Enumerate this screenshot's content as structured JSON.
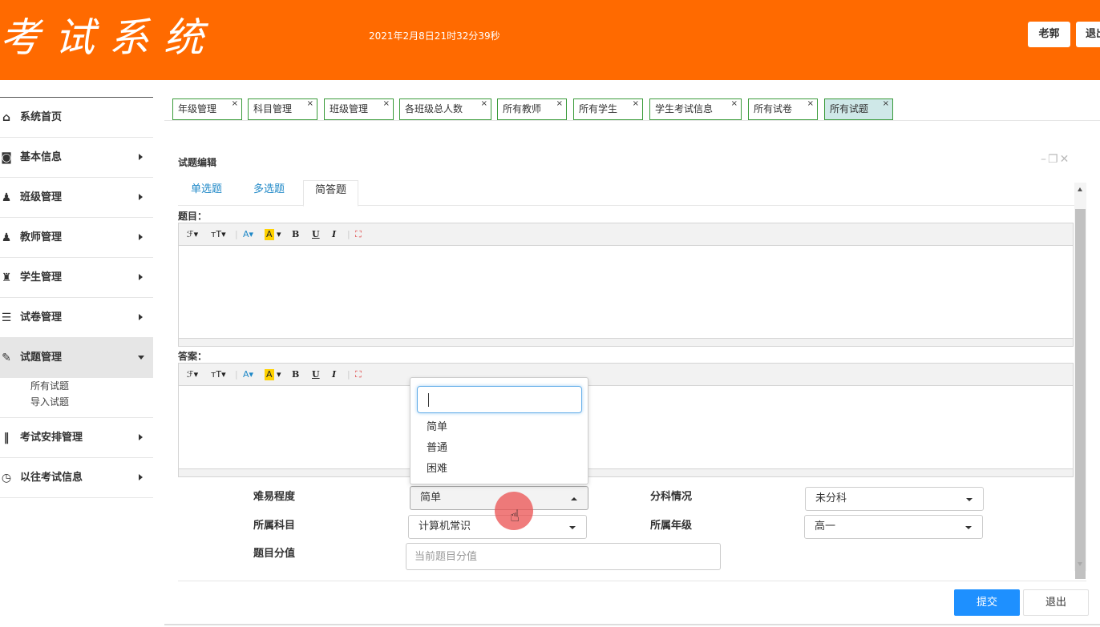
{
  "header": {
    "logo": "考试系统",
    "datetime": "2021年2月8日21时32分39秒",
    "user": "老郭",
    "exit": "退出"
  },
  "sidebar": {
    "items": [
      {
        "label": "系统首页",
        "icon": "home-icon"
      },
      {
        "label": "基本信息",
        "icon": "info-icon"
      },
      {
        "label": "班级管理",
        "icon": "class-icon"
      },
      {
        "label": "教师管理",
        "icon": "teacher-icon"
      },
      {
        "label": "学生管理",
        "icon": "student-icon"
      },
      {
        "label": "试卷管理",
        "icon": "paper-icon"
      },
      {
        "label": "试题管理",
        "icon": "question-icon"
      },
      {
        "label": "考试安排管理",
        "icon": "books-icon"
      },
      {
        "label": "以往考试信息",
        "icon": "clock-icon"
      }
    ],
    "submenu": [
      "所有试题",
      "导入试题"
    ]
  },
  "tabs": [
    "年级管理",
    "科目管理",
    "班级管理",
    "各班级总人数",
    "所有教师",
    "所有学生",
    "学生考试信息",
    "所有试卷",
    "所有试题"
  ],
  "panel": {
    "title": "试题编辑",
    "subtabs": [
      "单选题",
      "多选题",
      "简答题"
    ],
    "question_label": "题目：",
    "answer_label": "答案："
  },
  "form": {
    "difficulty_label": "难易程度",
    "difficulty_value": "简单",
    "subject_label": "所属科目",
    "subject_value": "计算机常识",
    "score_label": "题目分值",
    "score_placeholder": "当前题目分值",
    "branch_label": "分科情况",
    "branch_value": "未分科",
    "grade_label": "所属年级",
    "grade_value": "高一"
  },
  "dropdown": {
    "options": [
      "简单",
      "普通",
      "困难"
    ]
  },
  "buttons": {
    "submit": "提交",
    "quit": "退出"
  },
  "colors": {
    "header_bg": "#ff6a00",
    "tab_border": "#3a9b3a",
    "tab_active_bg": "#cfe8e8",
    "link": "#1e88c7",
    "primary": "#1e90ff"
  }
}
